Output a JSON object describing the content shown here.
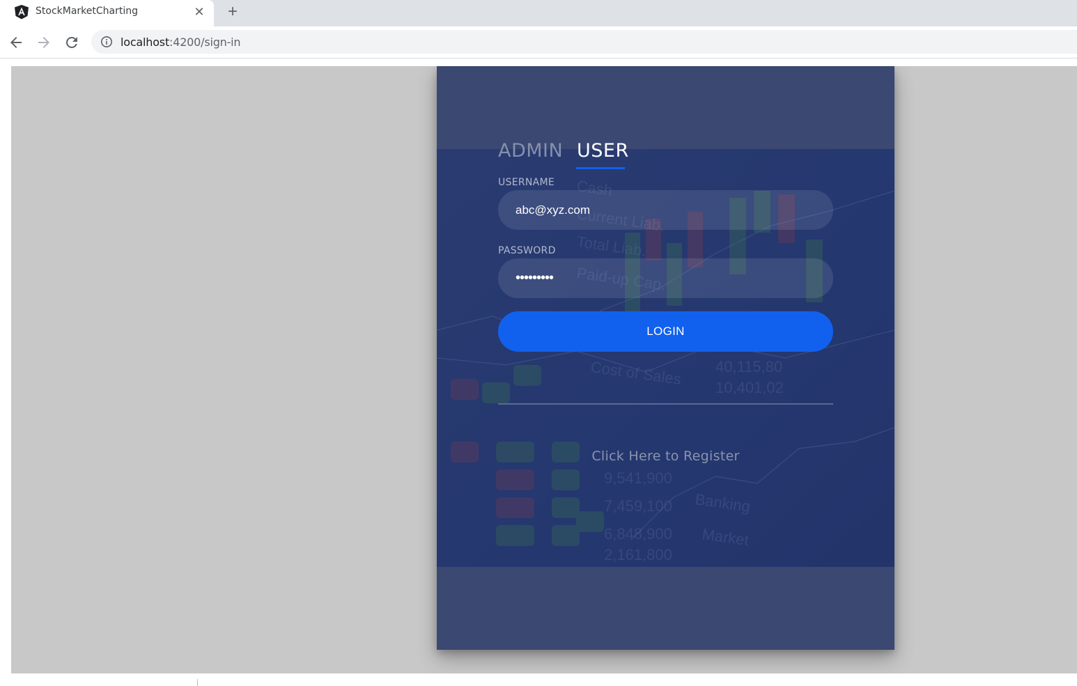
{
  "browser": {
    "tab_title": "StockMarketCharting",
    "url_host": "localhost",
    "url_path": ":4200/sign-in"
  },
  "login": {
    "tab_admin": "ADMIN",
    "tab_user": "USER",
    "active_tab": "USER",
    "username_label": "USERNAME",
    "username_value": "abc@xyz.com",
    "password_label": "PASSWORD",
    "password_value": "•••••••••",
    "login_button": "LOGIN",
    "register_link": "Click Here to Register"
  },
  "colors": {
    "card": "#3a4872",
    "accent": "#1161ee",
    "page_bg": "#c8c8c8"
  }
}
